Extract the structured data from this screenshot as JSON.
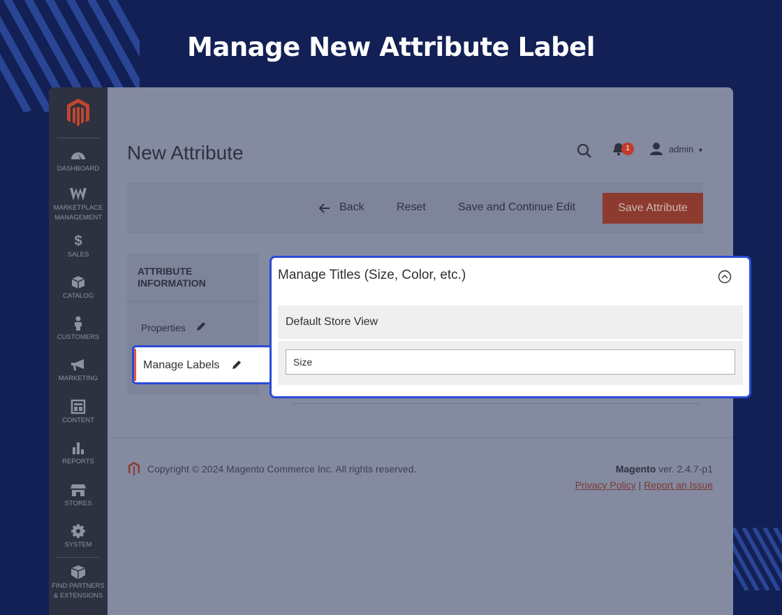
{
  "banner": {
    "title": "Manage New Attribute Label"
  },
  "sidebar": {
    "items": [
      {
        "label": "DASHBOARD",
        "icon": "dashboard-icon"
      },
      {
        "label": "MARKETPLACE MANAGEMENT",
        "icon": "marketplace-icon"
      },
      {
        "label": "SALES",
        "icon": "dollar-icon"
      },
      {
        "label": "CATALOG",
        "icon": "box-icon"
      },
      {
        "label": "CUSTOMERS",
        "icon": "person-icon"
      },
      {
        "label": "MARKETING",
        "icon": "megaphone-icon"
      },
      {
        "label": "CONTENT",
        "icon": "layout-icon"
      },
      {
        "label": "REPORTS",
        "icon": "bar-chart-icon"
      },
      {
        "label": "STORES",
        "icon": "store-icon"
      },
      {
        "label": "SYSTEM",
        "icon": "gear-icon"
      },
      {
        "label": "FIND PARTNERS & EXTENSIONS",
        "icon": "cubes-icon"
      }
    ]
  },
  "header": {
    "page_title": "New Attribute",
    "notifications_count": "1",
    "user": "admin"
  },
  "actions": {
    "back": "Back",
    "reset": "Reset",
    "save_continue": "Save and Continue Edit",
    "save": "Save Attribute"
  },
  "tabs": {
    "heading": "ATTRIBUTE INFORMATION",
    "properties": "Properties",
    "manage_labels": "Manage Labels"
  },
  "panel": {
    "title": "Manage Titles (Size, Color, etc.)",
    "store_view": "Default Store View",
    "value": "Size"
  },
  "footer": {
    "copyright": "Copyright © 2024 Magento Commerce Inc. All rights reserved.",
    "brand": "Magento",
    "version": " ver. 2.4.7-p1",
    "privacy": "Privacy Policy",
    "separator": " | ",
    "report": "Report an Issue"
  },
  "colors": {
    "background": "#122055",
    "accent": "#eb5202",
    "highlight_border": "#2a4bd7"
  }
}
